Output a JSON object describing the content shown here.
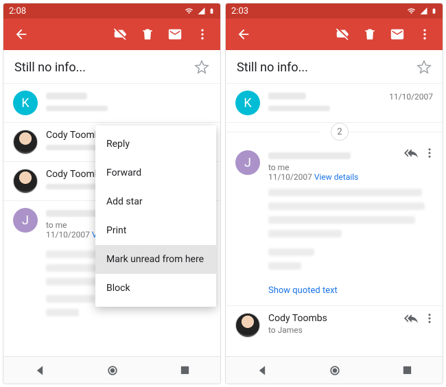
{
  "colors": {
    "accent": "#db4437",
    "statusbar": "#c5392c",
    "link": "#1a73e8"
  },
  "left": {
    "time": "2:08",
    "subject": "Still no info...",
    "messages": [
      {
        "avatar": "K"
      },
      {
        "sender": "Cody Toombs"
      },
      {
        "sender": "Cody Toombs"
      }
    ],
    "expanded": {
      "avatar": "J",
      "to": "to me",
      "date": "11/10/2007",
      "details": "View details"
    },
    "menu": {
      "items": [
        "Reply",
        "Forward",
        "Add star",
        "Print",
        "Mark unread from here",
        "Block"
      ],
      "highlight_index": 4
    }
  },
  "right": {
    "time": "2:03",
    "subject": "Still no info...",
    "first": {
      "avatar": "K",
      "date": "11/10/2007"
    },
    "collapsed_count": "2",
    "expanded": {
      "avatar": "J",
      "to": "to me",
      "date": "11/10/2007",
      "details": "View details"
    },
    "quoted_label": "Show quoted text",
    "last": {
      "sender": "Cody Toombs",
      "to": "to James"
    }
  }
}
